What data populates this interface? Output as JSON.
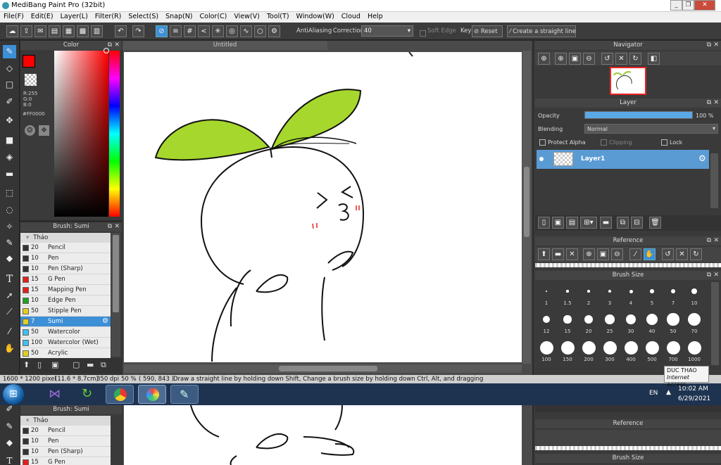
{
  "window": {
    "title": "MediBang Paint Pro (32bit)",
    "minimize": "_",
    "restore": "❐",
    "close": "✕"
  },
  "menu": [
    "File(F)",
    "Edit(E)",
    "Layer(L)",
    "Filter(R)",
    "Select(S)",
    "Snap(N)",
    "Color(C)",
    "View(V)",
    "Tool(T)",
    "Window(W)",
    "Cloud",
    "Help"
  ],
  "toolbar": {
    "antialiasing_label": "AntiAliasing",
    "correction_label": "Correction",
    "correction_value": "40",
    "soft_edge_label": "Soft Edge",
    "key_label": "Key",
    "reset_label": "Reset",
    "straight_line_label": "Create a straight line"
  },
  "color_panel": {
    "title": "Color",
    "r": "R:255",
    "g": "G:0",
    "b": "B:0",
    "hex": "#FF0000",
    "primary_color": "#ff0000"
  },
  "brush_panel": {
    "title": "Brush: Sumi",
    "group": "Thảo",
    "items": [
      {
        "size": "20",
        "name": "Pencil",
        "color": "#333333"
      },
      {
        "size": "10",
        "name": "Pen",
        "color": "#333333"
      },
      {
        "size": "10",
        "name": "Pen (Sharp)",
        "color": "#333333"
      },
      {
        "size": "15",
        "name": "G Pen",
        "color": "#e02020"
      },
      {
        "size": "15",
        "name": "Mapping Pen",
        "color": "#e02020"
      },
      {
        "size": "10",
        "name": "Edge Pen",
        "color": "#20a020"
      },
      {
        "size": "50",
        "name": "Stipple Pen",
        "color": "#e0d020"
      },
      {
        "size": "7",
        "name": "Sumi",
        "color": "#e0d020"
      },
      {
        "size": "50",
        "name": "Watercolor",
        "color": "#40c0f0"
      },
      {
        "size": "100",
        "name": "Watercolor (Wet)",
        "color": "#40c0f0"
      },
      {
        "size": "50",
        "name": "Acrylic",
        "color": "#e0d020"
      }
    ]
  },
  "canvas": {
    "tab_title": "Untitled"
  },
  "navigator": {
    "title": "Navigator"
  },
  "layer_panel": {
    "title": "Layer",
    "opacity_label": "Opacity",
    "opacity_value": "100 %",
    "opacity_fraction": 1.0,
    "blending_label": "Blending",
    "blending_value": "Normal",
    "protect_alpha": "Protect Alpha",
    "clipping": "Clipping",
    "lock": "Lock",
    "layer_name": "Layer1"
  },
  "reference": {
    "title": "Reference"
  },
  "brush_size": {
    "title": "Brush Size",
    "sizes": [
      "1",
      "1.5",
      "2",
      "3",
      "4",
      "5",
      "7",
      "10",
      "12",
      "15",
      "20",
      "25",
      "30",
      "40",
      "50",
      "70",
      "100",
      "150",
      "200",
      "300",
      "400",
      "500",
      "700",
      "1000"
    ]
  },
  "status": {
    "canvas_size": "1600 * 1200 pixel",
    "physical": "(11.6 * 8.7cm)",
    "dpi": "350 dpi",
    "zoom": "50 %",
    "coords": "( 590, 843 )",
    "hint": "Draw a straight line by holding down Shift, Change a brush size by holding down Ctrl, Alt, and dragging"
  },
  "tooltip": {
    "line1": "DUC THAO",
    "line2": "Internet access"
  },
  "taskbar": {
    "lang": "EN",
    "time": "10:02 AM",
    "date": "6/29/2021"
  },
  "duplicate": {
    "brush_title": "Brush: Sumi",
    "group": "Thảo",
    "items": [
      {
        "size": "20",
        "name": "Pencil",
        "color": "#333333"
      },
      {
        "size": "10",
        "name": "Pen",
        "color": "#333333"
      },
      {
        "size": "10",
        "name": "Pen (Sharp)",
        "color": "#333333"
      },
      {
        "size": "15",
        "name": "G Pen",
        "color": "#e02020"
      }
    ],
    "reference_title": "Reference",
    "brush_size_title": "Brush Size"
  }
}
